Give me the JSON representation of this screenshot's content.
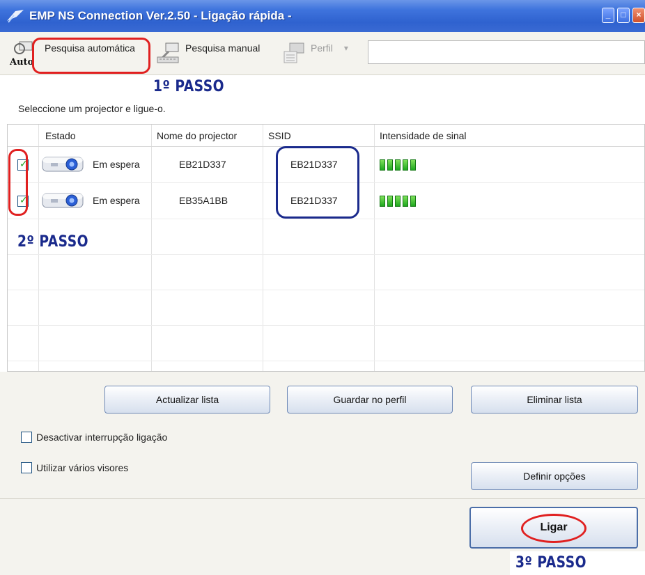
{
  "window": {
    "title": "EMP NS Connection Ver.2.50 - Ligação rápida -",
    "minimize_glyph": "_",
    "maximize_glyph": "□",
    "close_glyph": "×"
  },
  "toolbar": {
    "auto_icon_text": "Auto",
    "auto_search_label": "Pesquisa automática",
    "manual_search_label": "Pesquisa manual",
    "profile_label": "Perfil",
    "profile_dropdown_glyph": "▾"
  },
  "annotations": {
    "step1": "1º PASSO",
    "step2": "2º PASSO",
    "step3": "3º PASSO"
  },
  "instruction": "Seleccione um projector e ligue-o.",
  "table": {
    "headers": {
      "status": "Estado",
      "name": "Nome do projector",
      "ssid": "SSID",
      "signal": "Intensidade de sinal"
    },
    "rows": [
      {
        "checked": true,
        "status": "Em espera",
        "name": "EB21D337",
        "ssid": "EB21D337",
        "signal_bars": 5
      },
      {
        "checked": true,
        "status": "Em espera",
        "name": "EB35A1BB",
        "ssid": "EB21D337",
        "signal_bars": 5
      }
    ]
  },
  "buttons": {
    "refresh": "Actualizar lista",
    "save_profile": "Guardar no perfil",
    "clear_list": "Eliminar lista",
    "set_options": "Definir opções",
    "connect": "Ligar"
  },
  "options": {
    "disable_interrupt": {
      "label": "Desactivar interrupção ligação",
      "checked": false
    },
    "multi_display": {
      "label": "Utilizar vários visores",
      "checked": false
    }
  },
  "colors": {
    "title_bar": "#3f74dd",
    "annotation_red": "#e02020",
    "annotation_blue": "#1a2a8c",
    "signal_green": "#1fa81f"
  }
}
